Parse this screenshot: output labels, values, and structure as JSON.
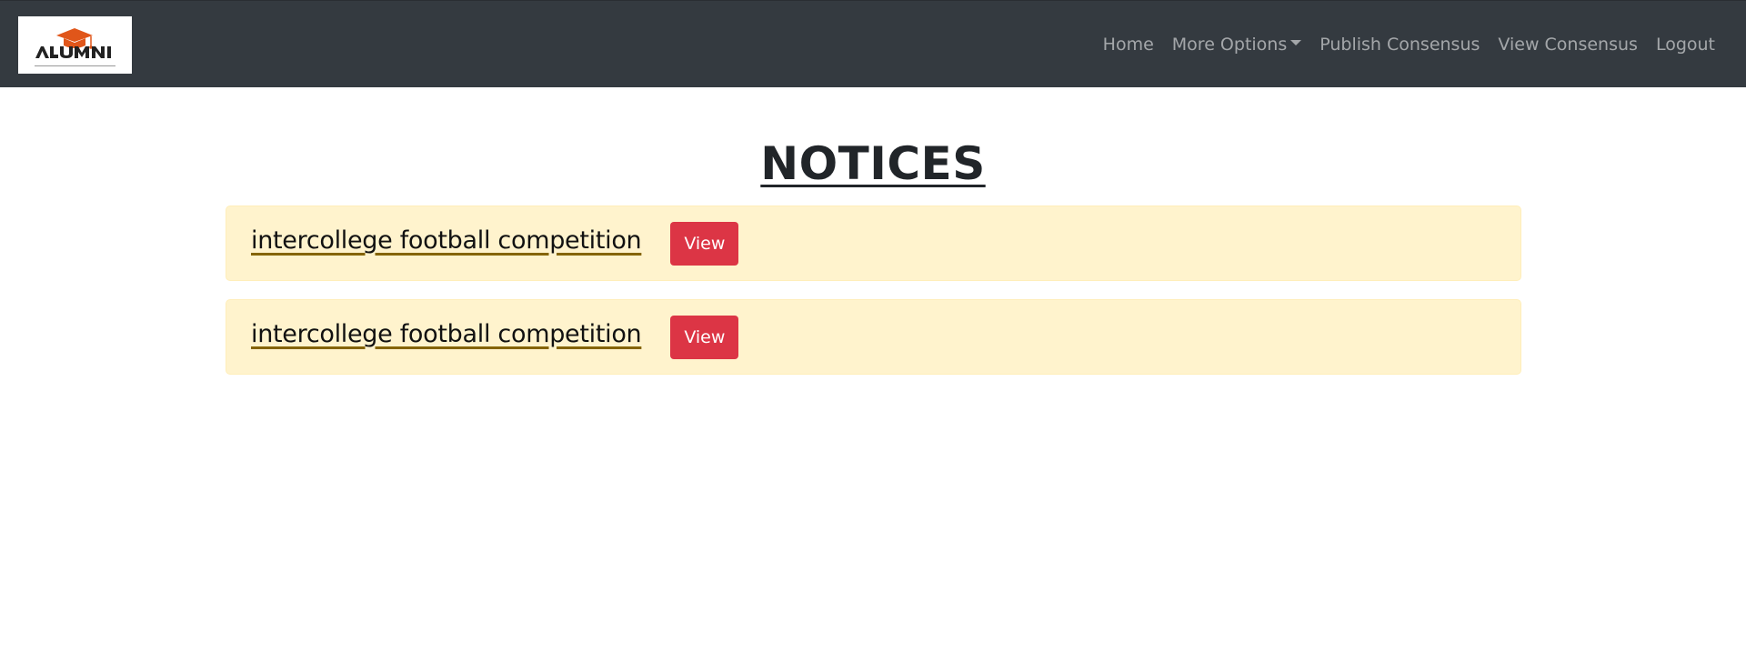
{
  "brand": {
    "logo_text": "ALUMNI",
    "colors": {
      "cap": "#e0561a",
      "text": "#222222"
    }
  },
  "nav": {
    "items": [
      {
        "label": "Home"
      },
      {
        "label": "More Options",
        "dropdown": true
      },
      {
        "label": "Publish Consensus"
      },
      {
        "label": "View Consensus"
      },
      {
        "label": "Logout"
      }
    ]
  },
  "page": {
    "title": "NOTICES"
  },
  "notices": [
    {
      "title": "intercollege football competition",
      "button_label": "View"
    },
    {
      "title": "intercollege football competition",
      "button_label": "View"
    }
  ],
  "colors": {
    "navbar_bg": "#343a40",
    "notice_bg": "#fff3cd",
    "button_bg": "#dc3545"
  }
}
